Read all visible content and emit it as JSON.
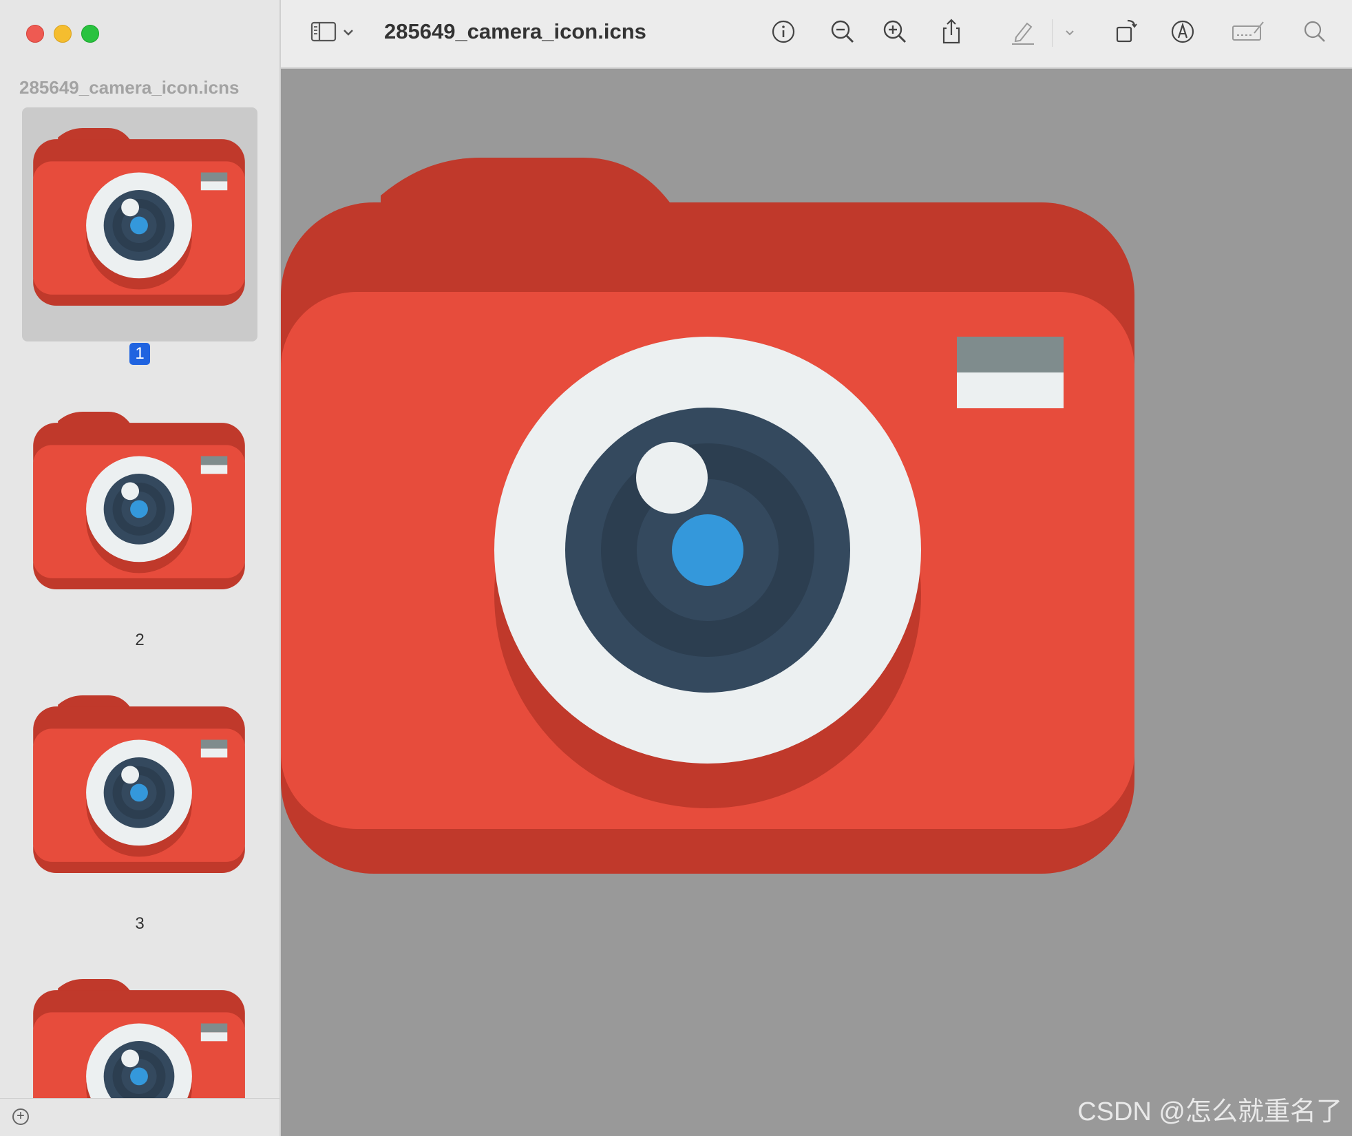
{
  "window": {
    "doc_title": "285649_camera_icon.icns",
    "sidebar_title": "285649_camera_icon.icns"
  },
  "sidebar": {
    "pages": [
      {
        "label": "1",
        "selected": true
      },
      {
        "label": "2",
        "selected": false
      },
      {
        "label": "3",
        "selected": false
      },
      {
        "label": "",
        "selected": false
      }
    ],
    "add_icon": "plus-circle-icon"
  },
  "toolbar": {
    "icons": [
      "sidebar-toggle-icon",
      "chevron-down-icon",
      "info-icon",
      "zoom-out-icon",
      "zoom-in-icon",
      "share-icon",
      "highlight-pen-icon",
      "chevron-down-icon",
      "rotate-icon",
      "markup-icon",
      "signature-icon",
      "search-icon"
    ]
  },
  "colors": {
    "camera_body": "#e74c3c",
    "camera_shadow": "#c0392b",
    "lens_ring": "#ecf0f1",
    "lens_outer": "#34495e",
    "lens_mid": "#2c3e50",
    "lens_iris": "#3498db",
    "flash_top": "#7f8c8d",
    "selection": "#1f63e0"
  },
  "watermark": "CSDN @怎么就重名了"
}
